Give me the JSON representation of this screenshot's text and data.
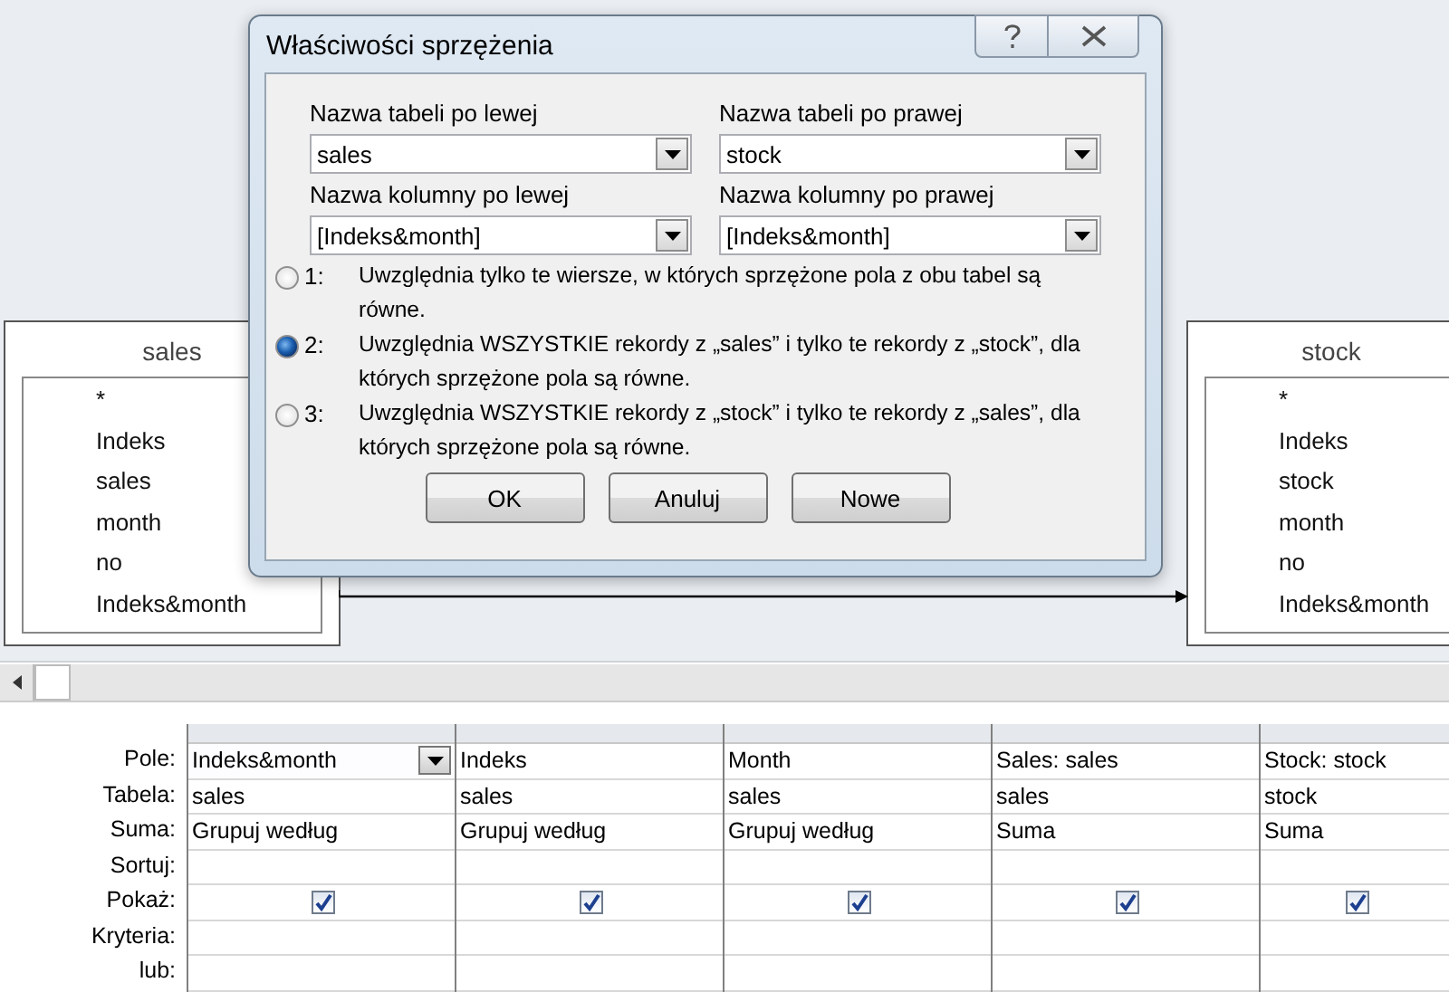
{
  "design_tables": [
    {
      "title": "sales",
      "fields": [
        "*",
        "Indeks",
        "sales",
        "month",
        "no",
        "Indeks&month"
      ]
    },
    {
      "title": "stock",
      "fields": [
        "*",
        "Indeks",
        "stock",
        "month",
        "no",
        "Indeks&month"
      ]
    }
  ],
  "dialog": {
    "title": "Właściwości sprzężenia",
    "left_table": {
      "label": "Nazwa tabeli po lewej",
      "value": "sales"
    },
    "right_table": {
      "label": "Nazwa tabeli po prawej",
      "value": "stock"
    },
    "left_column": {
      "label": "Nazwa kolumny po lewej",
      "value": "[Indeks&month]"
    },
    "right_column": {
      "label": "Nazwa kolumny po prawej",
      "value": "[Indeks&month]"
    },
    "options": [
      {
        "number": "1:",
        "text": "Uwzględnia tylko te wiersze, w których sprzężone pola z obu tabel są równe.",
        "selected": false
      },
      {
        "number": "2:",
        "text": "Uwzględnia WSZYSTKIE rekordy z „sales” i tylko te rekordy z „stock”, dla których sprzężone pola są równe.",
        "selected": true
      },
      {
        "number": "3:",
        "text": "Uwzględnia WSZYSTKIE rekordy z „stock” i tylko te rekordy z „sales”, dla których sprzężone pola są równe.",
        "selected": false
      }
    ],
    "buttons": [
      "OK",
      "Anuluj",
      "Nowe"
    ]
  },
  "grid": {
    "row_labels": [
      "Pole:",
      "Tabela:",
      "Suma:",
      "Sortuj:",
      "Pokaż:",
      "Kryteria:",
      "lub:"
    ],
    "columns": [
      {
        "field": "Indeks&month",
        "table": "sales",
        "total": "Grupuj według",
        "show": true,
        "selected": true
      },
      {
        "field": "Indeks",
        "table": "sales",
        "total": "Grupuj według",
        "show": true,
        "selected": false
      },
      {
        "field": "Month",
        "table": "sales",
        "total": "Grupuj według",
        "show": true,
        "selected": false
      },
      {
        "field": "Sales: sales",
        "table": "sales",
        "total": "Suma",
        "show": true,
        "selected": false
      },
      {
        "field": "Stock: stock",
        "table": "stock",
        "total": "Suma",
        "show": true,
        "selected": false
      }
    ]
  }
}
